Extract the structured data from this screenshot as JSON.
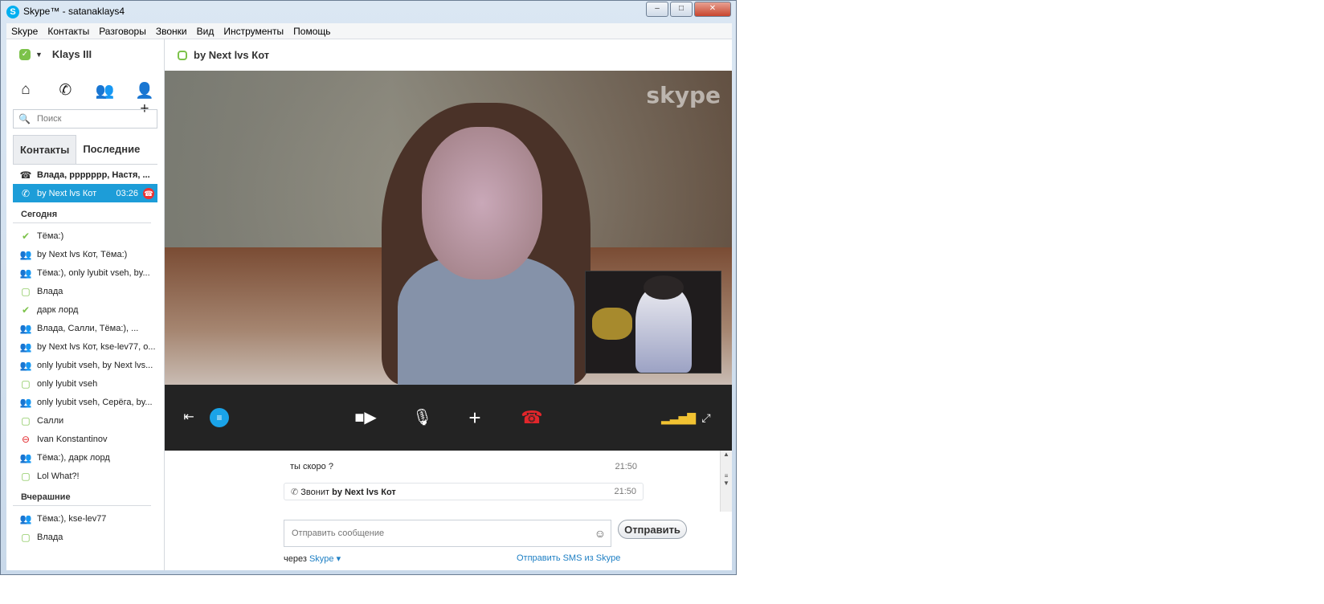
{
  "window": {
    "title": "Skype™ - satanaklays4",
    "logo": "S",
    "min": "–",
    "max": "□",
    "close": "✕"
  },
  "menu": [
    "Skype",
    "Контакты",
    "Разговоры",
    "Звонки",
    "Вид",
    "Инструменты",
    "Помощь"
  ],
  "profile": {
    "name": "Klays III"
  },
  "nav_icons": [
    "home-icon",
    "call-icon",
    "group-icon",
    "add-contact-icon"
  ],
  "search": {
    "placeholder": "Поиск"
  },
  "tabs": {
    "contacts": "Контакты",
    "recent": "Последние"
  },
  "active_calls": [
    {
      "label": "Влада, ppppppp, Настя, ...",
      "icon": "phone-icon"
    },
    {
      "label": "by Next lvs Кот",
      "duration": "03:26",
      "icon": "phone-icon"
    }
  ],
  "sections": {
    "today": "Сегодня",
    "yesterday": "Вчерашние"
  },
  "today": [
    {
      "label": "Тёма:)",
      "status": "online"
    },
    {
      "label": "by Next lvs Кот, Тёма:)",
      "status": "group"
    },
    {
      "label": "Тёма:), only lyubit vseh, by...",
      "status": "group"
    },
    {
      "label": "Влада",
      "status": "offline"
    },
    {
      "label": "дарк лорд",
      "status": "online"
    },
    {
      "label": "Влада, Салли, Тёма:), ...",
      "status": "group"
    },
    {
      "label": "by Next lvs Кот, kse-lev77, o...",
      "status": "group"
    },
    {
      "label": "only lyubit vseh, by Next lvs...",
      "status": "group"
    },
    {
      "label": "only lyubit vseh",
      "status": "offline"
    },
    {
      "label": "only lyubit vseh, Серёга, by...",
      "status": "group"
    },
    {
      "label": "Салли",
      "status": "offline"
    },
    {
      "label": "Ivan Konstantinov",
      "status": "busy"
    },
    {
      "label": "Тёма:), дарк лорд",
      "status": "group"
    },
    {
      "label": "Lol What?!",
      "status": "offline"
    }
  ],
  "yesterday": [
    {
      "label": "Тёма:), kse-lev77",
      "status": "group"
    },
    {
      "label": "Влада",
      "status": "offline"
    }
  ],
  "conversation": {
    "title": "by Next lvs Кот"
  },
  "video": {
    "watermark": "skype"
  },
  "callbar": {
    "signal": "▂▃▅▇"
  },
  "messages": [
    {
      "text": "ты скоро ?",
      "time": "21:50"
    },
    {
      "prefix": "Звонит",
      "name": "by Next lvs Кот",
      "time": "21:50"
    }
  ],
  "compose": {
    "placeholder": "Отправить сообщение",
    "send": "Отправить"
  },
  "footer": {
    "via_prefix": "через",
    "via_link": "Skype",
    "sms": "Отправить SMS из Skype"
  },
  "colors": {
    "accent": "#1d9dd8",
    "online": "#7cc24a",
    "busy": "#e2262b",
    "callbar": "#232323"
  }
}
